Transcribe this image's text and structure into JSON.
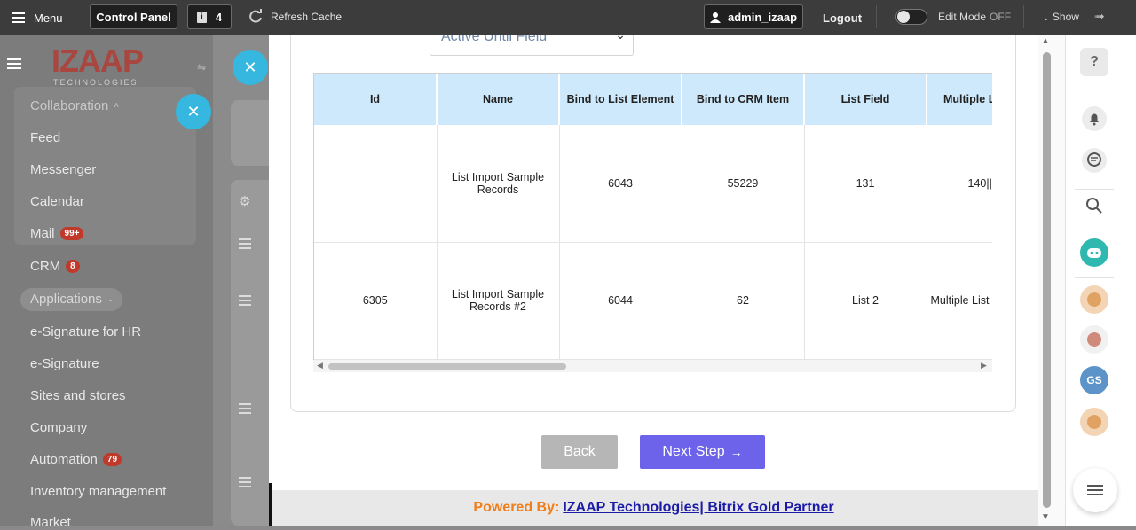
{
  "topbar": {
    "menu_label": "Menu",
    "control_panel_label": "Control Panel",
    "tasks_count": "4",
    "refresh_label": "Refresh Cache",
    "user_label": "admin_izaap",
    "logout_label": "Logout",
    "edit_mode_label": "Edit Mode",
    "edit_mode_state": "OFF",
    "show_label": "Show"
  },
  "sidebar": {
    "logo_text": "IZAAP",
    "logo_sub": "TECHNOLOGIES",
    "group_label": "Collaboration",
    "items": [
      {
        "label": "Feed"
      },
      {
        "label": "Messenger"
      },
      {
        "label": "Calendar"
      },
      {
        "label": "Mail",
        "badge": "99+"
      },
      {
        "label": "CRM",
        "badge": "8"
      },
      {
        "label": "Applications"
      },
      {
        "label": "e-Signature for HR"
      },
      {
        "label": "e-Signature"
      },
      {
        "label": "Sites and stores"
      },
      {
        "label": "Company"
      },
      {
        "label": "Automation",
        "badge": "79"
      },
      {
        "label": "Inventory management"
      },
      {
        "label": "Market"
      }
    ]
  },
  "modal": {
    "select_value": "Active Until Field",
    "table": {
      "headers": [
        "Id",
        "Name",
        "Bind to List Element",
        "Bind to CRM Item",
        "List Field",
        "Multiple L"
      ],
      "rows": [
        [
          "",
          "List Import Sample Records",
          "6043",
          "55229",
          "131",
          "140||"
        ],
        [
          "6305",
          "List Import Sample Records #2",
          "6044",
          "62",
          "List 2",
          "Multiple List List"
        ]
      ]
    },
    "back_label": "Back",
    "next_label": "Next Step",
    "footer_powered": "Powered By:",
    "footer_link": "IZAAP Technologies| Bitrix Gold Partner"
  },
  "rightbar": {
    "avatar_initials": "GS"
  },
  "colors": {
    "accent": "#6c63ea",
    "header_bg": "#cde9fb",
    "brand_orange": "#ef7d1a",
    "link_blue": "#1b1ba8",
    "badge_red": "#c0392b"
  }
}
